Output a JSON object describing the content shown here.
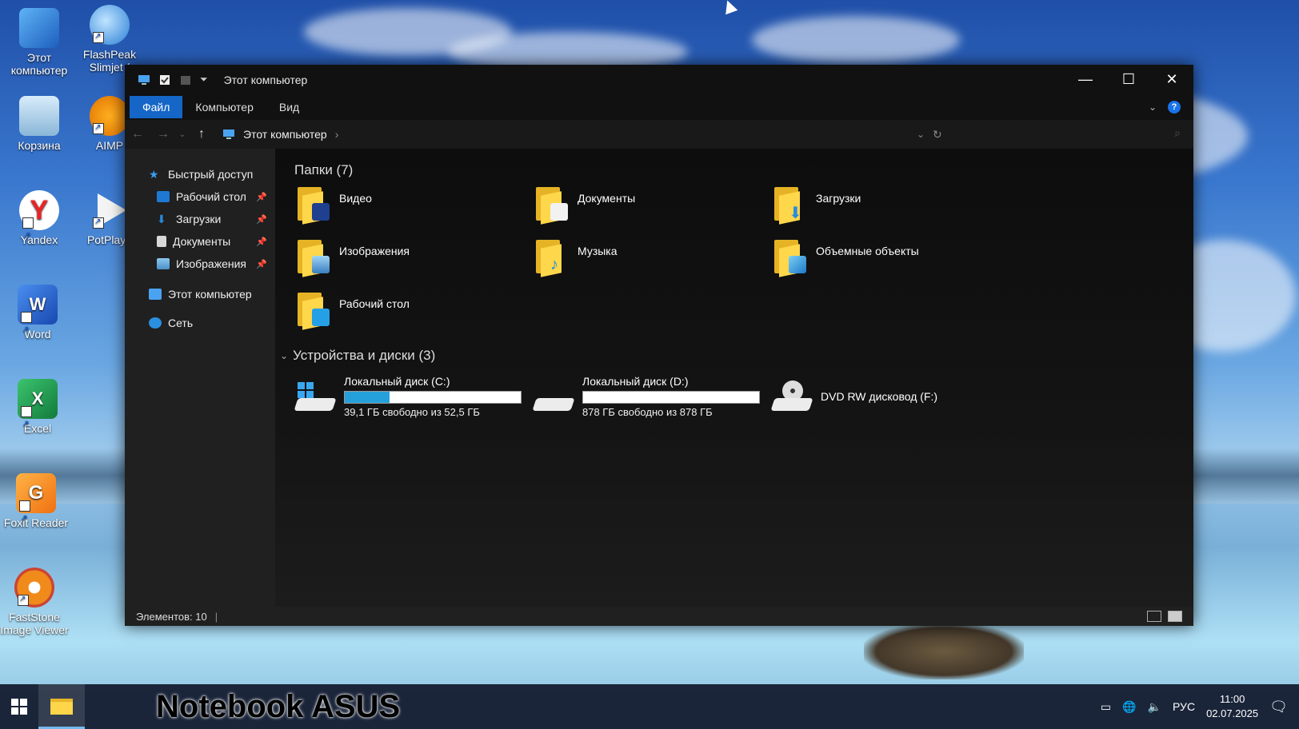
{
  "desktop": {
    "icons": [
      {
        "label": "Этот компьютер"
      },
      {
        "label": "FlashPeak Slimjet ("
      },
      {
        "label": "Корзина"
      },
      {
        "label": "AIMP"
      },
      {
        "label": "Yandex"
      },
      {
        "label": "PotPlaye"
      },
      {
        "label": "Word"
      },
      {
        "label": "Excel"
      },
      {
        "label": "Foxit Reader"
      },
      {
        "label": "FastStone Image Viewer"
      }
    ]
  },
  "window": {
    "title": "Этот компьютер",
    "ribbon_tabs": [
      "Файл",
      "Компьютер",
      "Вид"
    ],
    "help": "?",
    "address": {
      "path": "Этот компьютер",
      "separator": "›"
    },
    "nav": {
      "quick_access": "Быстрый доступ",
      "pinned": [
        "Рабочий стол",
        "Загрузки",
        "Документы",
        "Изображения"
      ],
      "this_pc": "Этот компьютер",
      "network": "Сеть"
    },
    "folders_header": "Папки (7)",
    "folders": [
      "Видео",
      "Документы",
      "Загрузки",
      "Изображения",
      "Музыка",
      "Объемные объекты",
      "Рабочий стол"
    ],
    "devices_header": "Устройства и диски (3)",
    "drives": [
      {
        "name": "Локальный диск (C:)",
        "free": "39,1 ГБ свободно из 52,5 ГБ",
        "used_fraction": 0.255
      },
      {
        "name": "Локальный диск (D:)",
        "free": "878 ГБ свободно из 878 ГБ",
        "used_fraction": 0.0
      },
      {
        "name": "DVD RW дисковод (F:)"
      }
    ],
    "status": "Элементов: 10"
  },
  "taskbar": {
    "overlay_label": "Notebook ASUS",
    "lang": "РУС",
    "time": "11:00",
    "date": "02.07.2025"
  },
  "colors": {
    "accent": "#1566c7",
    "drive_bar": "#26a0da",
    "folder": "#ffd74b"
  }
}
